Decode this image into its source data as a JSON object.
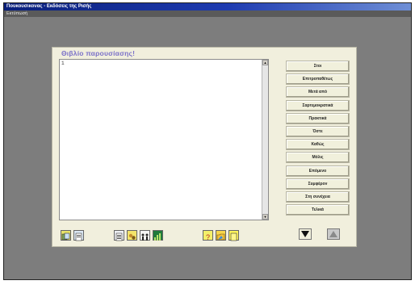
{
  "window": {
    "title": "Πουκουσικονας - Εκδόσεις της Ρισής"
  },
  "menubar": {
    "items": [
      "Εκτύπωσή"
    ]
  },
  "panel": {
    "heading": "Θιβλίο παρουσίασης!",
    "text_content": "1"
  },
  "buttons": [
    "Στοι",
    "Επιτροπαθέτως",
    "Μετά από",
    "Σαρτεμοκρατικά",
    "Πρακτικά",
    "Όστε",
    "Καθώς",
    "Μόλις",
    "Επόμενο",
    "Συμφέρον",
    "Στη συνέχεια",
    "Τελικά"
  ],
  "toolbar": {
    "icons": [
      "copy-icon",
      "paste-icon",
      "list-icon",
      "group-icon",
      "people-icon",
      "chart-icon",
      "help-icon",
      "folder-icon",
      "note-icon"
    ],
    "nav": [
      "scroll-down-icon",
      "scroll-up-icon"
    ]
  },
  "colors": {
    "background": "#7d7d7d",
    "panel": "#f1efdd",
    "heading": "#7a70c8",
    "titlebar": "#0a1f7a"
  }
}
